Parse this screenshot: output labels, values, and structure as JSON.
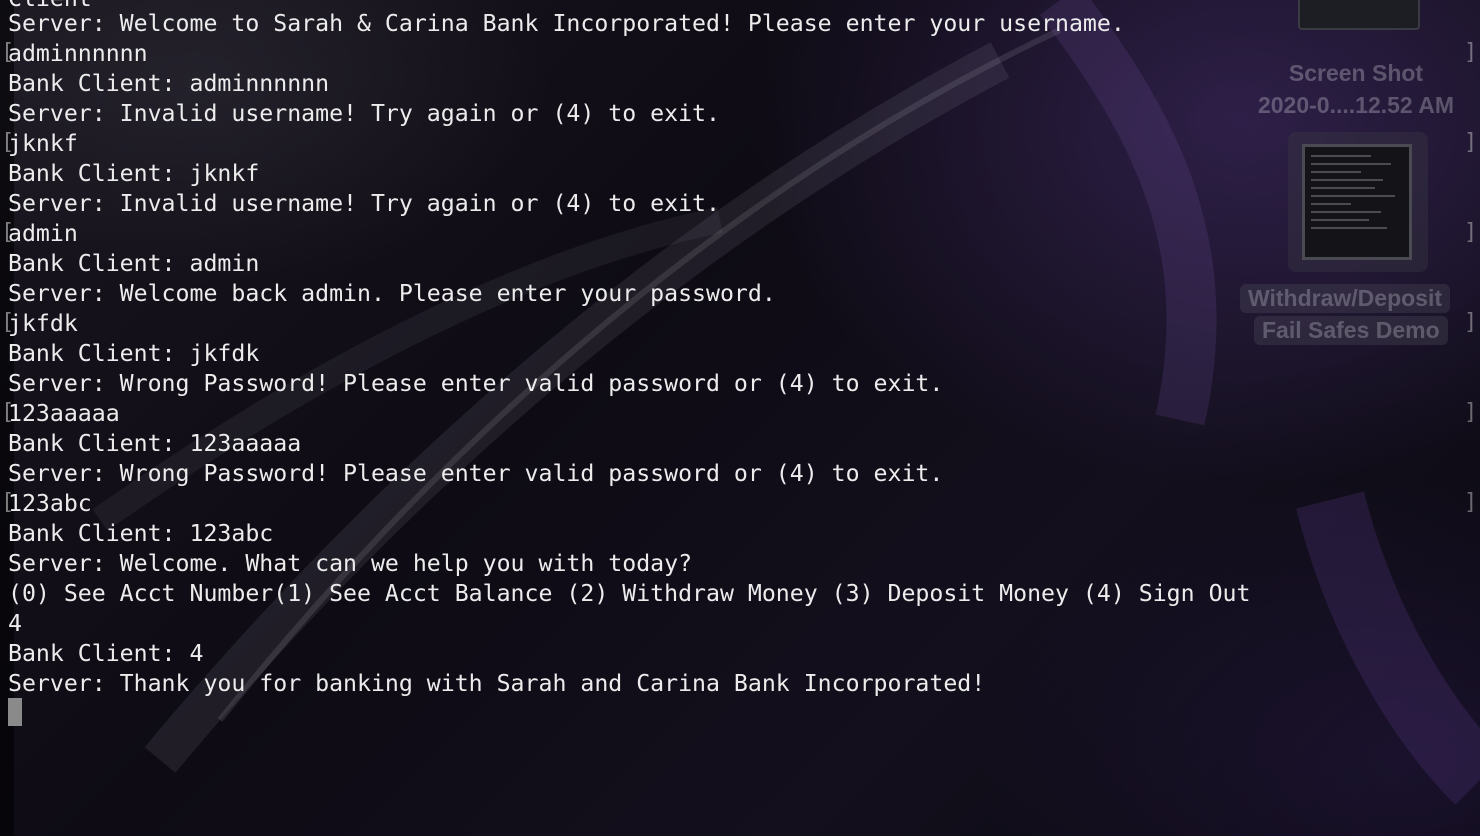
{
  "desktop": {
    "screenshot_label_line1": "Screen Shot",
    "screenshot_label_line2": "2020-0....12.52 AM",
    "folder_label_line1": "Withdraw/Deposit",
    "folder_label_line2": "Fail Safes Demo"
  },
  "terminal": {
    "clipped_top": "Client",
    "lines": [
      "Server: Welcome to Sarah & Carina Bank Incorporated! Please enter your username.",
      "adminnnnnn",
      "Bank Client: adminnnnnn",
      "Server: Invalid username! Try again or (4) to exit.",
      "jknkf",
      "Bank Client: jknkf",
      "Server: Invalid username! Try again or (4) to exit.",
      "admin",
      "Bank Client: admin",
      "Server: Welcome back admin. Please enter your password.",
      "jkfdk",
      "Bank Client: jkfdk",
      "Server: Wrong Password! Please enter valid password or (4) to exit.",
      "123aaaaa",
      "Bank Client: 123aaaaa",
      "Server: Wrong Password! Please enter valid password or (4) to exit.",
      "123abc",
      "Bank Client: 123abc",
      "Server: Welcome. What can we help you with today?",
      "(0) See Acct Number(1) See Acct Balance (2) Withdraw Money (3) Deposit Money (4) Sign Out",
      "4",
      "Bank Client: 4",
      "Server: Thank you for banking with Sarah and Carina Bank Incorporated!"
    ],
    "bracket_open": "[",
    "bracket_close": "]"
  }
}
